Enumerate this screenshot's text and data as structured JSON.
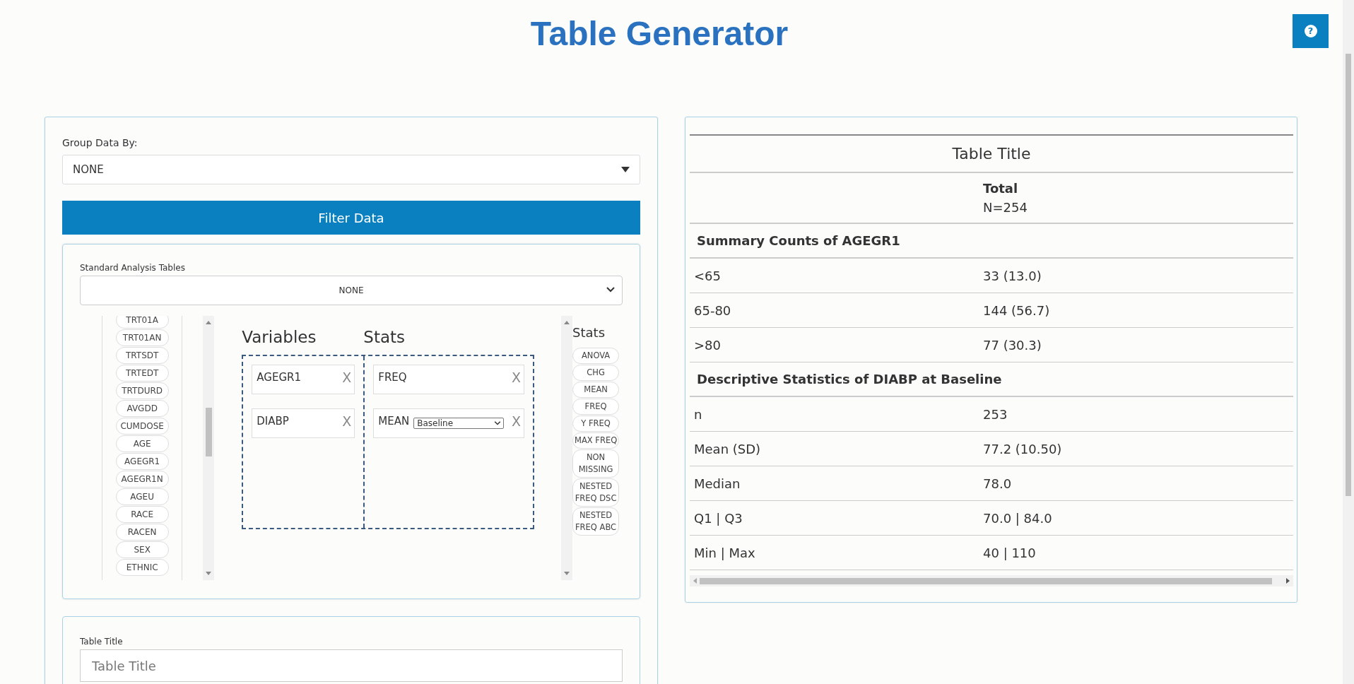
{
  "header": {
    "title": "Table Generator",
    "help_button": "?"
  },
  "builder": {
    "group_by": {
      "label": "Group Data By:",
      "value": "NONE"
    },
    "filter_button": "Filter Data",
    "standard_tables": {
      "label": "Standard Analysis Tables",
      "value": "NONE"
    },
    "variable_list": [
      "TRT01A",
      "TRT01AN",
      "TRTSDT",
      "TRTEDT",
      "TRTDURD",
      "AVGDD",
      "CUMDOSE",
      "AGE",
      "AGEGR1",
      "AGEGR1N",
      "AGEU",
      "RACE",
      "RACEN",
      "SEX",
      "ETHNIC"
    ],
    "variables_heading": "Variables",
    "stats_heading": "Stats",
    "selected_variables": [
      {
        "name": "AGEGR1",
        "remove": "X"
      },
      {
        "name": "DIABP",
        "remove": "X"
      }
    ],
    "selected_stats": [
      {
        "name": "FREQ",
        "remove": "X"
      },
      {
        "name": "MEAN",
        "option": "Baseline",
        "remove": "X"
      }
    ],
    "stats_palette": {
      "heading": "Stats",
      "items": [
        "ANOVA",
        "CHG",
        "MEAN",
        "FREQ",
        "Y FREQ",
        "MAX FREQ",
        "NON MISSING",
        "NESTED FREQ DSC",
        "NESTED FREQ ABC"
      ]
    },
    "table_title": {
      "label": "Table Title",
      "placeholder": "Table Title"
    }
  },
  "table": {
    "title": "Table Title",
    "column_header": {
      "name": "Total",
      "count": "N=254"
    },
    "sections": [
      {
        "heading": "Summary Counts of AGEGR1",
        "rows": [
          {
            "label": "<65",
            "value": "33 (13.0)"
          },
          {
            "label": "65-80",
            "value": "144 (56.7)"
          },
          {
            "label": ">80",
            "value": "77 (30.3)"
          }
        ]
      },
      {
        "heading": "Descriptive Statistics of DIABP at Baseline",
        "rows": [
          {
            "label": "n",
            "value": "253"
          },
          {
            "label": "Mean (SD)",
            "value": "77.2 (10.50)"
          },
          {
            "label": "Median",
            "value": "78.0"
          },
          {
            "label": "Q1 | Q3",
            "value": "70.0 | 84.0"
          },
          {
            "label": "Min | Max",
            "value": "40 | 110"
          }
        ]
      }
    ]
  }
}
